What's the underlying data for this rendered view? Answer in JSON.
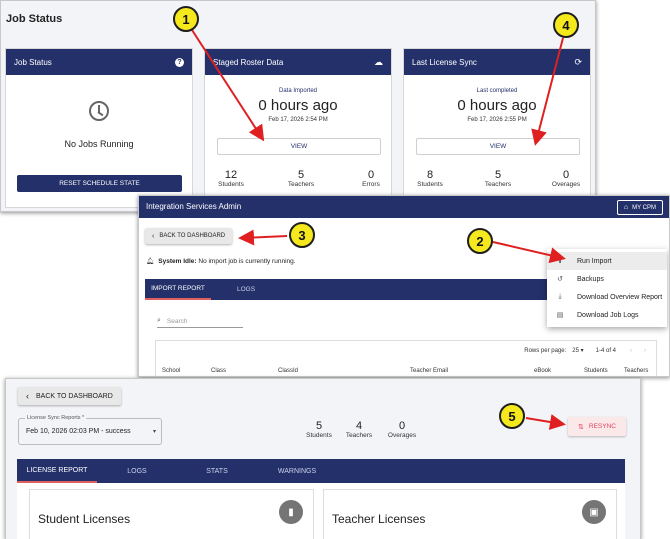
{
  "panel1": {
    "title": "Job Status",
    "job_card": {
      "header": "Job Status",
      "status": "No Jobs Running",
      "reset_label": "RESET SCHEDULE STATE"
    },
    "roster_card": {
      "header": "Staged Roster Data",
      "caption": "Data Imported",
      "value": "0 hours ago",
      "date": "Feb 17, 2026 2:54 PM",
      "view_label": "VIEW",
      "stats": [
        {
          "n": "12",
          "label": "Students"
        },
        {
          "n": "5",
          "label": "Teachers"
        },
        {
          "n": "0",
          "label": "Errors"
        }
      ]
    },
    "sync_card": {
      "header": "Last License Sync",
      "caption": "Last completed",
      "value": "0 hours ago",
      "date": "Feb 17, 2026 2:55 PM",
      "view_label": "VIEW",
      "stats": [
        {
          "n": "8",
          "label": "Students"
        },
        {
          "n": "5",
          "label": "Teachers"
        },
        {
          "n": "0",
          "label": "Overages"
        }
      ]
    }
  },
  "panel2": {
    "app_title": "Integration Services Admin",
    "my_cpm_label": "MY CPM",
    "back_label": "BACK TO DASHBOARD",
    "idle_bold": "System Idle:",
    "idle_text": " No import job is currently running.",
    "tabs": [
      "IMPORT REPORT",
      "LOGS"
    ],
    "search_placeholder": "Search",
    "rows_per_page_label": "Rows per page:",
    "rows_per_page_value": "25",
    "range": "1-4 of 4",
    "columns": [
      "School",
      "Class",
      "ClassId",
      "Teacher Email",
      "eBook",
      "Students",
      "Teachers"
    ],
    "menu": [
      {
        "icon": "cloud-upload-icon",
        "glyph": "⬆",
        "label": "Run Import"
      },
      {
        "icon": "history-icon",
        "glyph": "↺",
        "label": "Backups"
      },
      {
        "icon": "download-icon",
        "glyph": "⤓",
        "label": "Download Overview Report"
      },
      {
        "icon": "file-icon",
        "glyph": "▤",
        "label": "Download Job Logs"
      }
    ]
  },
  "panel3": {
    "back_label": "BACK TO DASHBOARD",
    "select_label": "License Sync Reports *",
    "select_value": "Feb 10, 2026 02:03 PM - success",
    "stats": [
      {
        "n": "5",
        "label": "Students"
      },
      {
        "n": "4",
        "label": "Teachers"
      },
      {
        "n": "0",
        "label": "Overages"
      }
    ],
    "resync_label": "RESYNC",
    "tabs": [
      "LICENSE REPORT",
      "LOGS",
      "STATS",
      "WARNINGS"
    ],
    "student_title": "Student Licenses",
    "teacher_title": "Teacher Licenses"
  },
  "callouts": [
    "1",
    "2",
    "3",
    "4",
    "5"
  ],
  "colors": {
    "navy": "#23306a",
    "callout": "#f5e81c",
    "arrow": "#e02020",
    "accent_red": "#e06060"
  }
}
